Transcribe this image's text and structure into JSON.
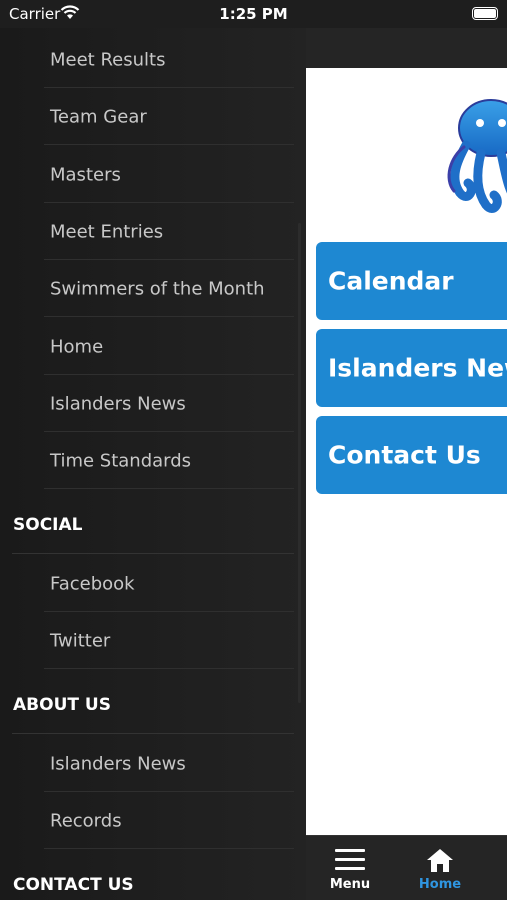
{
  "status_bar": {
    "carrier": "Carrier",
    "time": "1:25 PM",
    "icons": [
      "wifi-icon",
      "battery-icon"
    ]
  },
  "drawer": {
    "items_top": [
      {
        "label": "Meet Results"
      },
      {
        "label": "Team Gear"
      },
      {
        "label": "Masters"
      },
      {
        "label": "Meet Entries"
      },
      {
        "label": "Swimmers of the Month"
      },
      {
        "label": "Home"
      },
      {
        "label": "Islanders News"
      },
      {
        "label": "Time Standards"
      }
    ],
    "sections": [
      {
        "title": "SOCIAL",
        "items": [
          {
            "label": "Facebook"
          },
          {
            "label": "Twitter"
          }
        ]
      },
      {
        "title": "ABOUT US",
        "items": [
          {
            "label": "Islanders News"
          },
          {
            "label": "Records"
          }
        ]
      },
      {
        "title": "CONTACT US",
        "items": []
      }
    ]
  },
  "main": {
    "logo_icon": "octopus-logo-icon",
    "buttons": [
      {
        "label": "Calendar"
      },
      {
        "label": "Islanders News"
      },
      {
        "label": "Contact Us"
      }
    ],
    "accent_color": "#1e88d2"
  },
  "tab_bar": {
    "tabs": [
      {
        "label": "Menu",
        "icon": "hamburger-menu-icon",
        "active": false
      },
      {
        "label": "Home",
        "icon": "home-icon",
        "active": true
      }
    ],
    "active_color": "#2f95e0"
  }
}
